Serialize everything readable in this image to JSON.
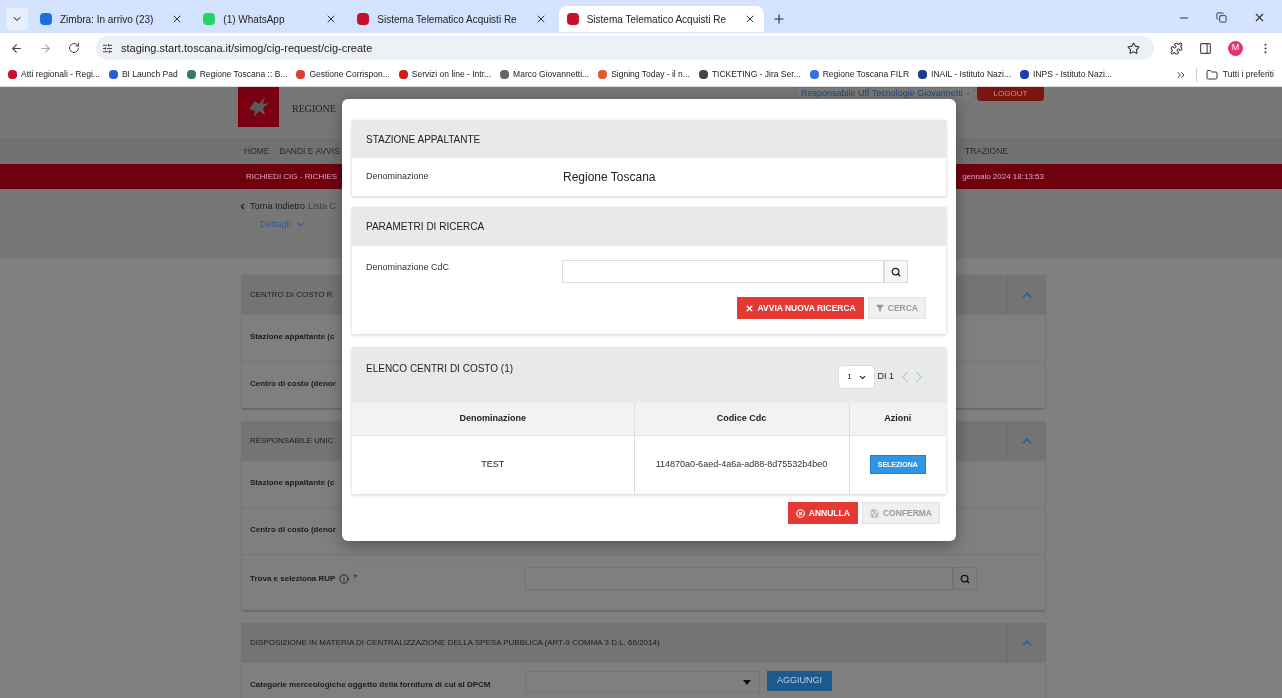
{
  "browser": {
    "tabs": [
      {
        "title": "Zimbra: In arrivo (23)",
        "selected": false
      },
      {
        "title": "(1) WhatsApp",
        "selected": false
      },
      {
        "title": "Sistema Telematico Acquisti Re",
        "selected": false
      },
      {
        "title": "Sistema Telematico Acquisti Re",
        "selected": true
      }
    ],
    "url": "staging.start.toscana.it/simog/cig-request/cig-create",
    "avatar": "M",
    "bookmarks": [
      "Atti regionali - Regi...",
      "BI Launch Pad",
      "Regione Toscana :: B...",
      "Gestione Corrispon...",
      "Servizi on line - Intr...",
      "Marco Giovannetti...",
      "Signing Today - il n...",
      "TICKETING - Jira Ser...",
      "Regione Toscana FILR",
      "INAIL - Istituto Nazi...",
      "INPS - Istituto Nazi..."
    ],
    "bookmarks_folder": "Tutti i preferiti"
  },
  "page": {
    "header": {
      "brand": "REGIONE",
      "user": "Responsabile Uff Tecnologie Giovannetti",
      "logout": "LOGOUT"
    },
    "nav": [
      "HOME",
      "BANDI E AVVIS",
      "TRAZIONE"
    ],
    "banner": {
      "left": "RICHIEDI CIG - RICHIES",
      "right": "gennaio 2024 18:13:53"
    },
    "breadcrumb": {
      "back": "Torna Indietro",
      "current": "Lista C",
      "details": "Dettagli"
    },
    "panels": [
      {
        "title": "CENTRO DI COSTO R",
        "expanded": true,
        "rows": [
          {
            "kind": "text",
            "label": "Stazione appaltante (c"
          },
          {
            "kind": "text",
            "label": "Centro di costo (denor"
          }
        ]
      },
      {
        "title": "RESPONSABILE UNIC",
        "expanded": true,
        "rows": [
          {
            "kind": "text",
            "label": "Stazione appaltante (c"
          },
          {
            "kind": "text",
            "label": "Centro di costo (denor"
          },
          {
            "kind": "search",
            "label": "Trova e seleziona RUP",
            "required_mark": "*"
          }
        ]
      },
      {
        "title": "DISPOSIZIONE IN MATERIA DI CENTRALIZZAZIONE DELLA SPESA PUBBLICA (ART-9 COMMA 3 D.L. 66/2014)",
        "expanded": true,
        "rows": [
          {
            "kind": "select",
            "label": "Categorie merceologiche oggetto della fornitura di cui al DPCM",
            "button": "AGGIUNGI"
          }
        ]
      }
    ]
  },
  "modal": {
    "station": {
      "title": "STAZIONE APPALTANTE",
      "label": "Denominazione",
      "value": "Regione Toscana"
    },
    "search": {
      "title": "PARAMETRI DI RICERCA",
      "label": "Denominazione CdC",
      "reset": "AVVIA NUOVA RICERCA",
      "search": "CERCA",
      "search_disabled": true
    },
    "list": {
      "title": "ELENCO CENTRI DI COSTO (1)",
      "page": "1",
      "of": "DI 1",
      "columns": [
        "Denominazione",
        "Codice Cdc",
        "Azioni"
      ],
      "rows": [
        {
          "name": "TEST",
          "code": "114870a0-6aed-4a6a-ad88-8d75532b4be0",
          "action": "SELEZIONA"
        }
      ]
    },
    "cancel": "ANNULLA",
    "confirm": "CONFERMA",
    "confirm_disabled": true
  }
}
